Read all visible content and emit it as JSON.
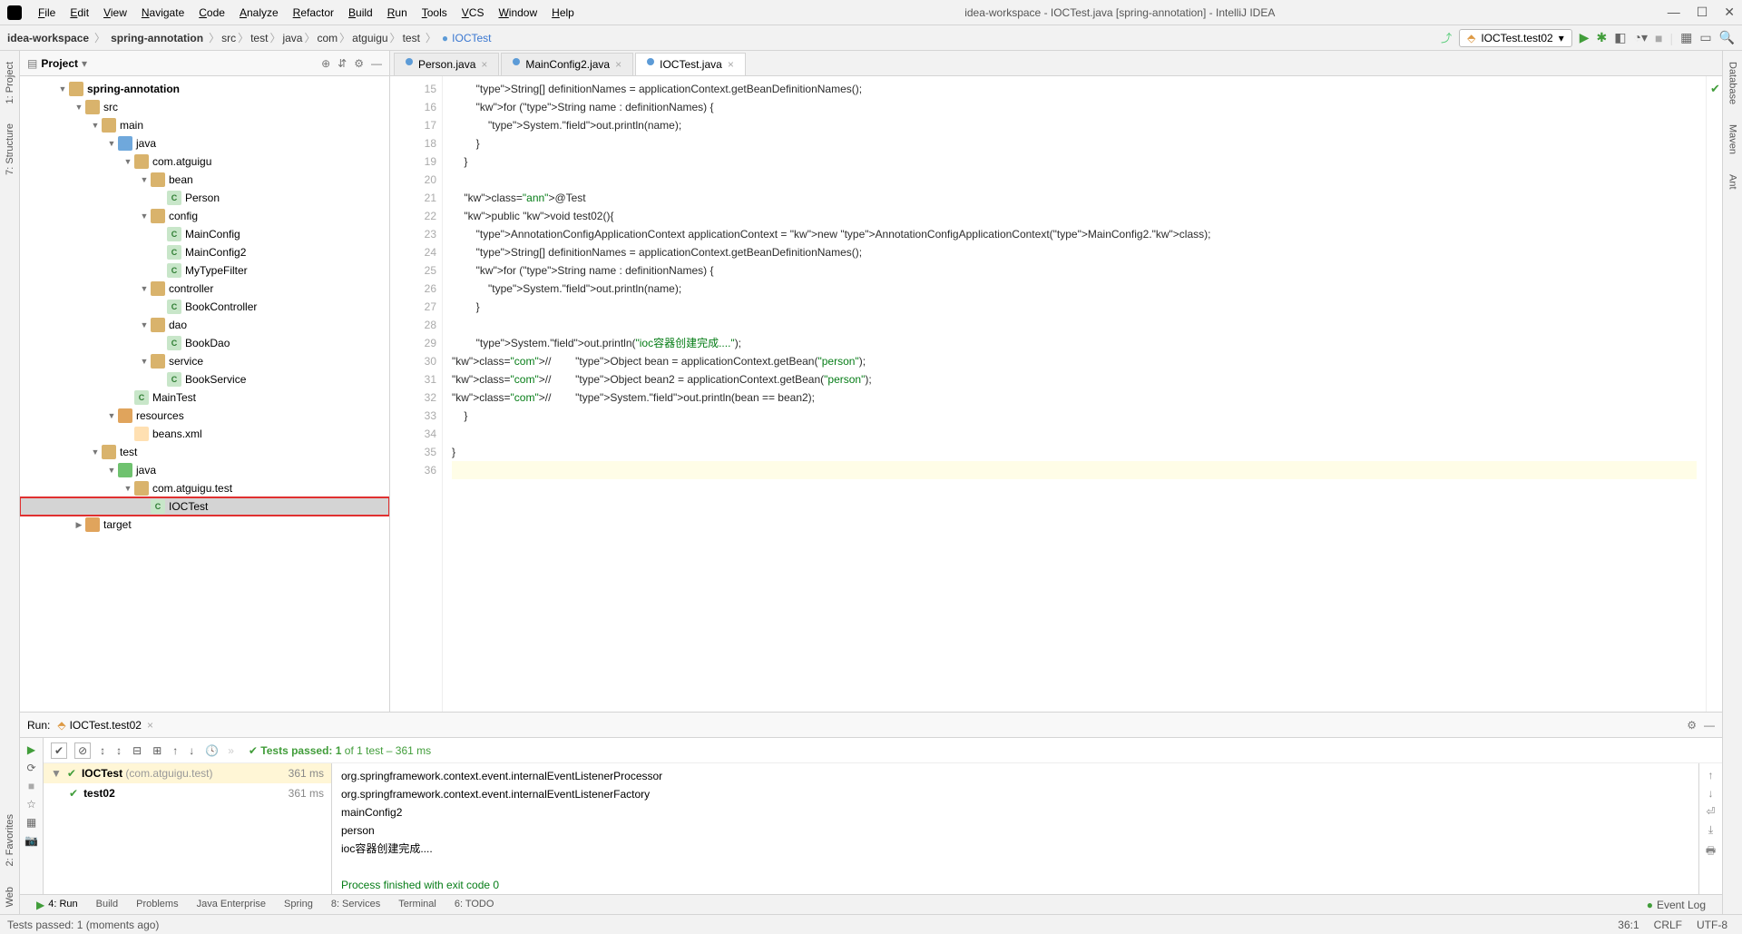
{
  "window": {
    "title": "idea-workspace - IOCTest.java [spring-annotation] - IntelliJ IDEA",
    "menu": [
      "File",
      "Edit",
      "View",
      "Navigate",
      "Code",
      "Analyze",
      "Refactor",
      "Build",
      "Run",
      "Tools",
      "VCS",
      "Window",
      "Help"
    ]
  },
  "breadcrumbs": {
    "root": "idea-workspace",
    "module": "spring-annotation",
    "path": [
      "src",
      "test",
      "java",
      "com",
      "atguigu",
      "test"
    ],
    "file": "IOCTest",
    "run_target": "IOCTest.test02"
  },
  "project": {
    "title": "Project",
    "tree": [
      {
        "indent": 0,
        "arrow": "▼",
        "icon": "folder",
        "label": "spring-annotation",
        "bold": true
      },
      {
        "indent": 1,
        "arrow": "▼",
        "icon": "folder",
        "label": "src"
      },
      {
        "indent": 2,
        "arrow": "▼",
        "icon": "folder",
        "label": "main"
      },
      {
        "indent": 3,
        "arrow": "▼",
        "icon": "folder-blue",
        "label": "java"
      },
      {
        "indent": 4,
        "arrow": "▼",
        "icon": "folder",
        "label": "com.atguigu"
      },
      {
        "indent": 5,
        "arrow": "▼",
        "icon": "folder",
        "label": "bean"
      },
      {
        "indent": 6,
        "arrow": "",
        "icon": "class",
        "label": "Person"
      },
      {
        "indent": 5,
        "arrow": "▼",
        "icon": "folder",
        "label": "config"
      },
      {
        "indent": 6,
        "arrow": "",
        "icon": "class",
        "label": "MainConfig"
      },
      {
        "indent": 6,
        "arrow": "",
        "icon": "class",
        "label": "MainConfig2"
      },
      {
        "indent": 6,
        "arrow": "",
        "icon": "class",
        "label": "MyTypeFilter"
      },
      {
        "indent": 5,
        "arrow": "▼",
        "icon": "folder",
        "label": "controller"
      },
      {
        "indent": 6,
        "arrow": "",
        "icon": "class",
        "label": "BookController"
      },
      {
        "indent": 5,
        "arrow": "▼",
        "icon": "folder",
        "label": "dao"
      },
      {
        "indent": 6,
        "arrow": "",
        "icon": "class",
        "label": "BookDao"
      },
      {
        "indent": 5,
        "arrow": "▼",
        "icon": "folder",
        "label": "service"
      },
      {
        "indent": 6,
        "arrow": "",
        "icon": "class",
        "label": "BookService"
      },
      {
        "indent": 4,
        "arrow": "",
        "icon": "class",
        "label": "MainTest"
      },
      {
        "indent": 3,
        "arrow": "▼",
        "icon": "folder-orange",
        "label": "resources"
      },
      {
        "indent": 4,
        "arrow": "",
        "icon": "xml",
        "label": "beans.xml"
      },
      {
        "indent": 2,
        "arrow": "▼",
        "icon": "folder",
        "label": "test"
      },
      {
        "indent": 3,
        "arrow": "▼",
        "icon": "folder-green",
        "label": "java"
      },
      {
        "indent": 4,
        "arrow": "▼",
        "icon": "folder",
        "label": "com.atguigu.test"
      },
      {
        "indent": 5,
        "arrow": "",
        "icon": "class",
        "label": "IOCTest",
        "selected": true,
        "highlight": true
      },
      {
        "indent": 1,
        "arrow": "▶",
        "icon": "folder-orange",
        "label": "target"
      }
    ]
  },
  "editor": {
    "tabs": [
      {
        "label": "Person.java",
        "active": false
      },
      {
        "label": "MainConfig2.java",
        "active": false
      },
      {
        "label": "IOCTest.java",
        "active": true
      }
    ],
    "first_line": 15,
    "code": [
      "        String[] definitionNames = applicationContext.getBeanDefinitionNames();",
      "        for (String name : definitionNames) {",
      "            System.out.println(name);",
      "        }",
      "    }",
      "",
      "    @Test",
      "    public void test02(){",
      "        AnnotationConfigApplicationContext applicationContext = new AnnotationConfigApplicationContext(MainConfig2.class);",
      "        String[] definitionNames = applicationContext.getBeanDefinitionNames();",
      "        for (String name : definitionNames) {",
      "            System.out.println(name);",
      "        }",
      "",
      "        System.out.println(\"ioc容器创建完成....\");",
      "//        Object bean = applicationContext.getBean(\"person\");",
      "//        Object bean2 = applicationContext.getBean(\"person\");",
      "//        System.out.println(bean == bean2);",
      "    }",
      "",
      "}",
      ""
    ]
  },
  "run": {
    "title": "Run:",
    "config": "IOCTest.test02",
    "summary_prefix": "Tests passed: 1",
    "summary_suffix": " of 1 test – 361 ms",
    "tests": [
      {
        "label": "IOCTest",
        "pkg": "(com.atguigu.test)",
        "time": "361 ms",
        "root": true
      },
      {
        "label": "test02",
        "time": "361 ms",
        "root": false
      }
    ],
    "console": [
      "org.springframework.context.event.internalEventListenerProcessor",
      "org.springframework.context.event.internalEventListenerFactory",
      "mainConfig2",
      "person",
      "ioc容器创建完成....",
      "",
      "Process finished with exit code 0"
    ]
  },
  "bottom_tabs": {
    "items": [
      "4: Run",
      "Build",
      "Problems",
      "Java Enterprise",
      "Spring",
      "8: Services",
      "Terminal",
      "6: TODO"
    ],
    "event_log": "Event Log"
  },
  "status": {
    "left": "Tests passed: 1 (moments ago)",
    "pos": "36:1",
    "enc": "CRLF",
    "other": "UTF-8"
  },
  "side_tabs": {
    "left": [
      "1: Project",
      "7: Structure",
      "2: Favorites",
      "Web"
    ],
    "right": [
      "Database",
      "Maven",
      "Ant"
    ]
  }
}
